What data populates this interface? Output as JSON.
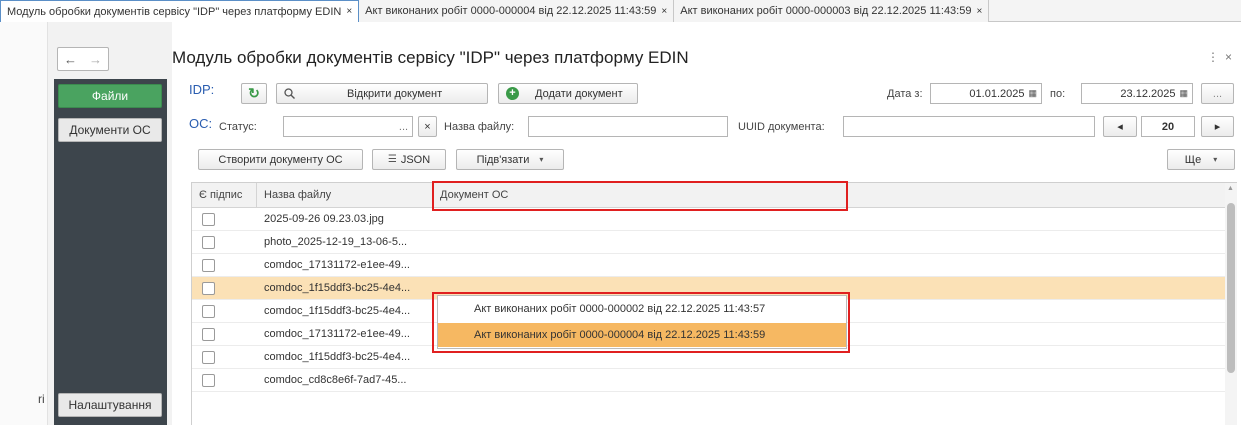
{
  "tabs": [
    {
      "label": "Модуль обробки документів сервісу \"IDP\" через платформу EDIN",
      "active": true
    },
    {
      "label": "Акт виконаних робіт 0000-000004 від 22.12.2025 11:43:59",
      "active": false
    },
    {
      "label": "Акт виконаних робіт 0000-000003 від 22.12.2025 11:43:59",
      "active": false
    }
  ],
  "tab_close": "×",
  "left_stub": "ri",
  "nav": {
    "back": "←",
    "forward": "→",
    "files": "Файли",
    "os_docs": "Документи ОС",
    "settings": "Налаштування"
  },
  "page_title": "Модуль обробки документів сервісу \"IDP\" через платформу EDIN",
  "window_controls": {
    "more": "⋮",
    "close": "×"
  },
  "idp": {
    "label": "IDP:",
    "refresh_icon": "↻",
    "search_icon": "search-icon",
    "open_doc": "Відкрити документ",
    "add_doc": "Додати документ",
    "date_from_label": "Дата з:",
    "date_from": "01.01.2025",
    "date_to_label": "по:",
    "date_to": "23.12.2025",
    "more_dots": "..."
  },
  "os": {
    "label": "ОС:",
    "status_label": "Статус:",
    "status_value": "",
    "dots": "...",
    "clear": "×",
    "filename_label": "Назва файлу:",
    "filename_value": "",
    "uuid_label": "UUID документа:",
    "uuid_value": "",
    "page_prev": "◂",
    "page_size": "20",
    "page_next": "▸"
  },
  "toolbar": {
    "create_os": "Створити документу ОС",
    "json": "JSON",
    "link": "Підв'язати",
    "more": "Ще"
  },
  "table": {
    "headers": [
      "Є підпис",
      "Назва файлу",
      "Документ ОС"
    ],
    "rows": [
      {
        "file": "2025-09-26 09.23.03.jpg",
        "highlight": false
      },
      {
        "file": "photo_2025-12-19_13-06-5...",
        "highlight": false
      },
      {
        "file": "comdoc_17131172-e1ee-49...",
        "highlight": false
      },
      {
        "file": "comdoc_1f15ddf3-bc25-4e4...",
        "highlight": true
      },
      {
        "file": "comdoc_1f15ddf3-bc25-4e4...",
        "highlight": false
      },
      {
        "file": "comdoc_17131172-e1ee-49...",
        "highlight": false
      },
      {
        "file": "comdoc_1f15ddf3-bc25-4e4...",
        "highlight": false
      },
      {
        "file": "comdoc_cd8c8e6f-7ad7-45...",
        "highlight": false
      }
    ]
  },
  "popup": [
    {
      "label": "Акт виконаних робіт 0000-000002 від 22.12.2025 11:43:57",
      "selected": false
    },
    {
      "label": "Акт виконаних робіт 0000-000004 від 22.12.2025 11:43:59",
      "selected": true
    }
  ],
  "colors": {
    "accent_green": "#4aa360",
    "highlight_row": "#fbe1b6",
    "popup_selected": "#f6b862",
    "annotation_red": "#e02020"
  }
}
